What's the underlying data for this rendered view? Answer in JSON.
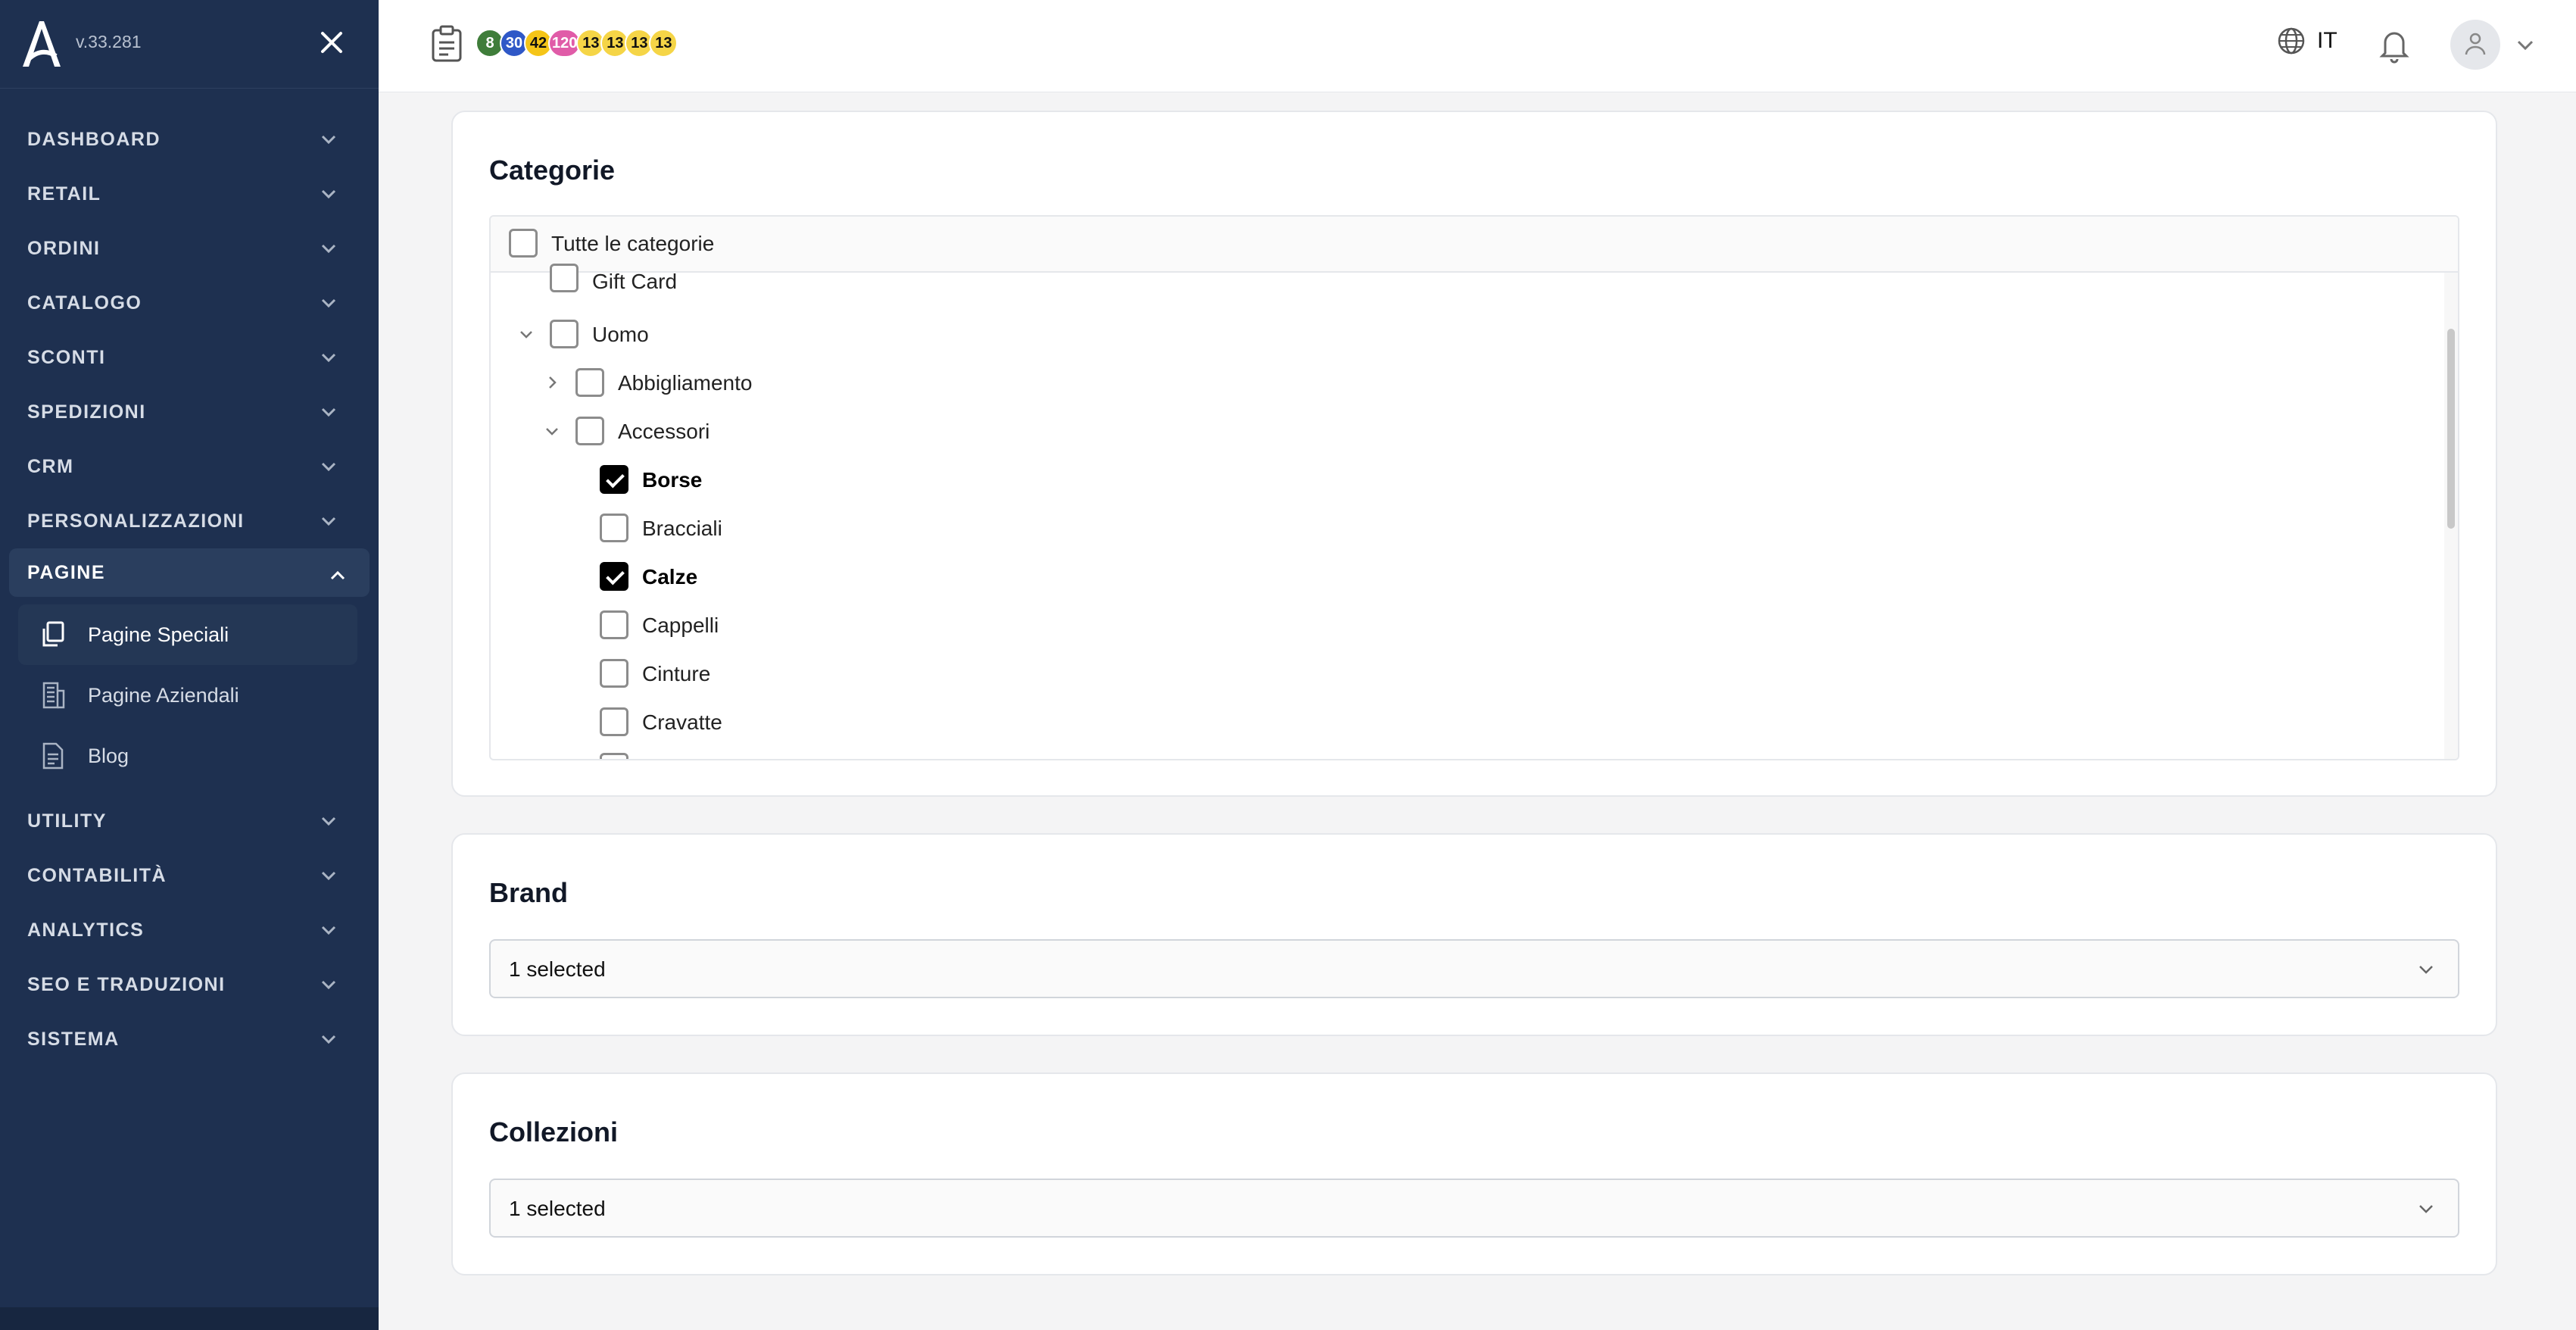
{
  "app": {
    "version": "v.33.281",
    "brand_color": "#1e3050"
  },
  "sidebar": {
    "items": [
      {
        "label": "DASHBOARD"
      },
      {
        "label": "RETAIL"
      },
      {
        "label": "ORDINI"
      },
      {
        "label": "CATALOGO"
      },
      {
        "label": "SCONTI"
      },
      {
        "label": "SPEDIZIONI"
      },
      {
        "label": "CRM"
      },
      {
        "label": "PERSONALIZZAZIONI"
      },
      {
        "label": "PAGINE",
        "expanded": true
      },
      {
        "label": "UTILITY"
      },
      {
        "label": "CONTABILITÀ"
      },
      {
        "label": "ANALYTICS"
      },
      {
        "label": "SEO E TRADUZIONI"
      },
      {
        "label": "SISTEMA"
      }
    ],
    "pagine_children": [
      {
        "label": "Pagine Speciali",
        "icon": "copy-pages-icon",
        "active": true
      },
      {
        "label": "Pagine Aziendali",
        "icon": "building-icon"
      },
      {
        "label": "Blog",
        "icon": "document-icon"
      }
    ]
  },
  "topbar": {
    "badges": [
      {
        "value": "8",
        "color": "#3f7d3a",
        "text_color": "#ffffff"
      },
      {
        "value": "30",
        "color": "#2f58c7",
        "text_color": "#ffffff"
      },
      {
        "value": "42",
        "color": "#f5c518",
        "text_color": "#111111"
      },
      {
        "value": "120",
        "color": "#e05ca8",
        "text_color": "#ffffff"
      },
      {
        "value": "13",
        "color": "#f5d547",
        "text_color": "#111111"
      },
      {
        "value": "13",
        "color": "#f5d547",
        "text_color": "#111111"
      },
      {
        "value": "13",
        "color": "#f5d547",
        "text_color": "#111111"
      },
      {
        "value": "13",
        "color": "#f5d547",
        "text_color": "#111111"
      }
    ],
    "language": "IT"
  },
  "categorie": {
    "title": "Categorie",
    "all_label": "Tutte le categorie",
    "tree": [
      {
        "label": "Gift Card",
        "checked": false
      },
      {
        "label": "Uomo",
        "checked": false,
        "expanded": true
      },
      {
        "label": "Abbigliamento",
        "checked": false,
        "expanded": false
      },
      {
        "label": "Accessori",
        "checked": false,
        "expanded": true
      },
      {
        "label": "Borse",
        "checked": true
      },
      {
        "label": "Bracciali",
        "checked": false
      },
      {
        "label": "Calze",
        "checked": true
      },
      {
        "label": "Cappelli",
        "checked": false
      },
      {
        "label": "Cinture",
        "checked": false
      },
      {
        "label": "Cravatte",
        "checked": false
      }
    ]
  },
  "brand": {
    "title": "Brand",
    "value": "1 selected"
  },
  "collezioni": {
    "title": "Collezioni",
    "value": "1 selected"
  }
}
